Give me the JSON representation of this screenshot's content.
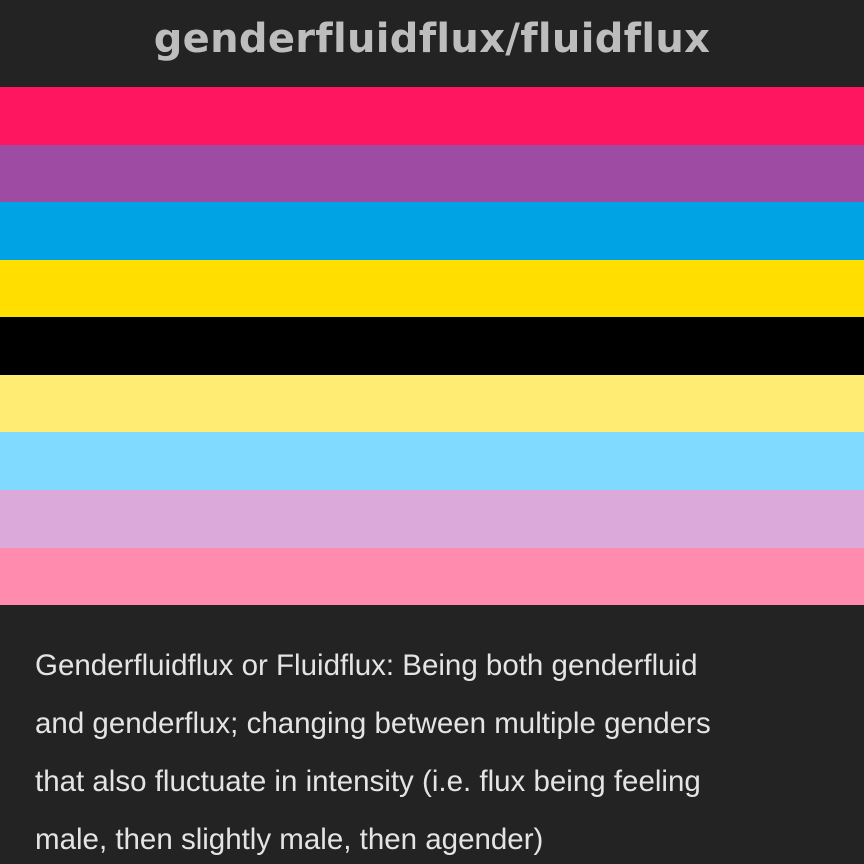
{
  "title": "genderfluidflux/fluidflux",
  "flag": {
    "stripes": [
      "#ff1660",
      "#9d4ba3",
      "#00a3e4",
      "#ffde00",
      "#000000",
      "#ffec73",
      "#80daff",
      "#dbaadb",
      "#ff8cae"
    ]
  },
  "description": {
    "lines": [
      "Genderfluidflux or Fluidflux: Being both genderfluid",
      "and genderflux; changing between multiple genders",
      "that also fluctuate in intensity (i.e. flux being feeling",
      "male, then slightly male, then agender)"
    ]
  }
}
